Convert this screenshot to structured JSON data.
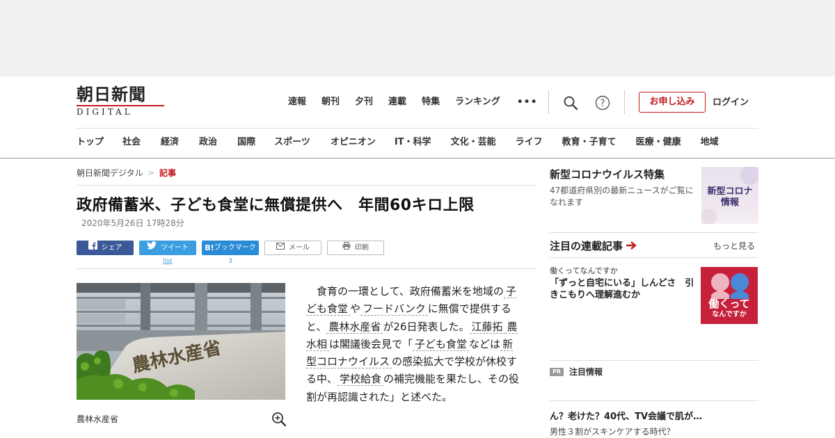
{
  "header": {
    "logo_main": "朝日新聞",
    "logo_sub": "DIGITAL",
    "top_nav": [
      "速報",
      "朝刊",
      "夕刊",
      "連載",
      "特集",
      "ランキング"
    ],
    "more_label": "•••",
    "subscribe_label": "お申し込み",
    "login_label": "ログイン",
    "categories": [
      "トップ",
      "社会",
      "経済",
      "政治",
      "国際",
      "スポーツ",
      "オピニオン",
      "IT・科学",
      "文化・芸能",
      "ライフ",
      "教育・子育て",
      "医療・健康",
      "地域"
    ]
  },
  "breadcrumb": {
    "home": "朝日新聞デジタル",
    "separator": ">",
    "current": "記事"
  },
  "article": {
    "headline": "政府備蓄米、子ども食堂に無償提供へ　年間60キロ上限",
    "date": "2020年5月26日 17時28分",
    "share": {
      "facebook": "シェア",
      "twitter": "ツイート",
      "twitter_count": "list",
      "hatena_mark": "B!",
      "hatena": "ブックマーク",
      "hatena_count": "3",
      "mail": "メール",
      "print": "印刷"
    },
    "photo_caption": "農林水産省",
    "photo_sign_text": "農林水産省",
    "body": {
      "t1": "食育の一環として、政府備蓄米を地域の",
      "k1": "子ども食堂",
      "t2": "や",
      "k2": "フードバンク",
      "t3": "に無償で提供すると、",
      "k3": "農林水産省",
      "t4": "が26日発表した。",
      "k4": "江藤拓",
      "k5": "農水相",
      "t5": "は閣議後会見で「",
      "k6": "子ども食堂",
      "t6": "などは",
      "k7": "新型コロナウイルス",
      "t7": "の感染拡大で学校が休校する中、",
      "k8": "学校給食",
      "t8": "の補完機能を果たし、その役割が再認識された」と述べた。"
    }
  },
  "sidebar": {
    "promo": {
      "title": "新型コロナウイルス特集",
      "desc": "47都道府県別の最新ニュースがご覧になれます",
      "thumb_line1": "新型コロナ",
      "thumb_line2": "情報"
    },
    "series": {
      "title": "注目の連載記事",
      "more": "もっと見る",
      "label": "働くってなんですか",
      "headline": "「ずっと自宅にいる」しんどさ　引きこもりへ理解進むか",
      "thumb_line1": "働くって",
      "thumb_line2": "なんですか"
    },
    "pr": {
      "badge": "PR",
      "title": "注目情報",
      "headline": "ん？老けた？40代、TV会議で肌が…",
      "sub": "男性３割がスキンケアする時代？"
    }
  },
  "colors": {
    "brand_red": "#c4161c",
    "facebook": "#3b5998",
    "twitter": "#3b9ee0",
    "hatena": "#2a8bd6"
  }
}
